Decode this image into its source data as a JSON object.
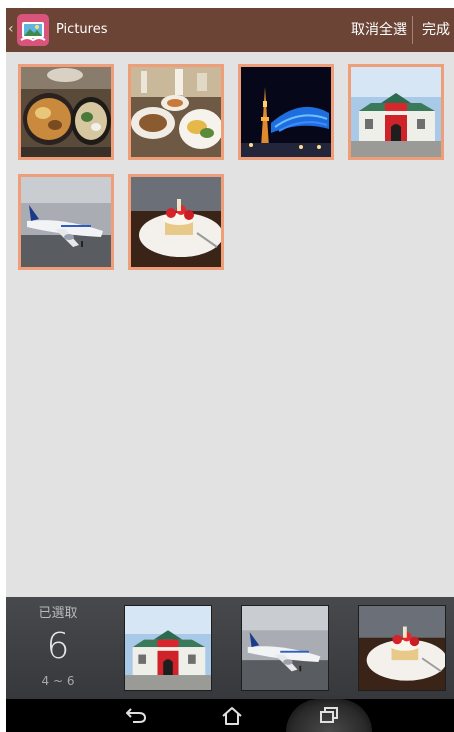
{
  "top_bar": {
    "back_icon": "chevron-left-icon",
    "app_icon": "pictures-app-icon",
    "title": "Pictures",
    "deselect_all_label": "取消全選",
    "done_label": "完成",
    "background_color": "#6b4436"
  },
  "grid": {
    "items": [
      {
        "subject": "noodle and rice bowls on a table",
        "selected": true
      },
      {
        "subject": "restaurant table with plates of food",
        "selected": true
      },
      {
        "subject": "tower and blue lit building at night",
        "selected": true
      },
      {
        "subject": "red and white Japanese style building",
        "selected": true
      },
      {
        "subject": "airplane on runway",
        "selected": true
      },
      {
        "subject": "strawberry cake on a plate",
        "selected": true
      }
    ],
    "selection_border_color": "#ef9e7a"
  },
  "selection_tray": {
    "label": "已選取",
    "count": "6",
    "range": "4 ~ 6",
    "thumbnails": [
      {
        "subject": "red and white Japanese style building"
      },
      {
        "subject": "airplane on runway"
      },
      {
        "subject": "strawberry cake on a plate"
      }
    ]
  },
  "nav_bar": {
    "buttons": [
      "back-icon",
      "home-icon",
      "recent-apps-icon"
    ]
  }
}
